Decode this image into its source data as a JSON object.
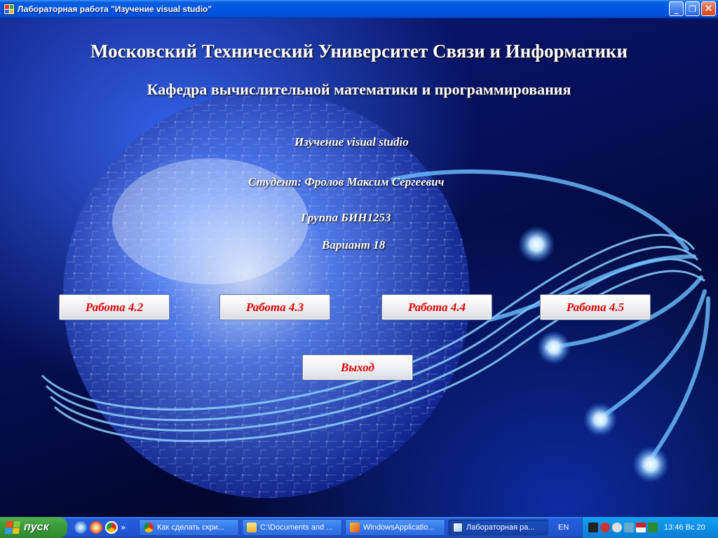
{
  "window": {
    "title": "Лабораторная работа \"Изучение visual studio\"",
    "minimize_icon": "minimize-icon",
    "maximize_icon": "maximize-icon",
    "close_icon": "close-icon"
  },
  "header": {
    "university": "Московский Технический Университет Связи и Информатики",
    "department": "Кафедра вычислительной математики и программирования"
  },
  "info": {
    "topic": "Изучение visual studio",
    "student": "Студент: Фролов Максим Сергеевич",
    "group": "Группа БИН1253",
    "variant": "Вариант 18"
  },
  "buttons": {
    "work_4_2": "Работа 4.2",
    "work_4_3": "Работа 4.3",
    "work_4_4": "Работа 4.4",
    "work_4_5": "Работа 4.5",
    "exit": "Выход",
    "label_color": "#e00000"
  },
  "taskbar": {
    "start_label": "пуск",
    "chevron": "»",
    "tasks": [
      {
        "label": "Как сделать скри...",
        "icon": "chrome-icon"
      },
      {
        "label": "C:\\Documents and ...",
        "icon": "folder-icon"
      },
      {
        "label": "WindowsApplicatio...",
        "icon": "visual-studio-icon"
      },
      {
        "label": "Лабораторная ра...",
        "icon": "form-window-icon",
        "active": true
      }
    ],
    "language": "EN",
    "clock": "13:46 Вс 20"
  }
}
